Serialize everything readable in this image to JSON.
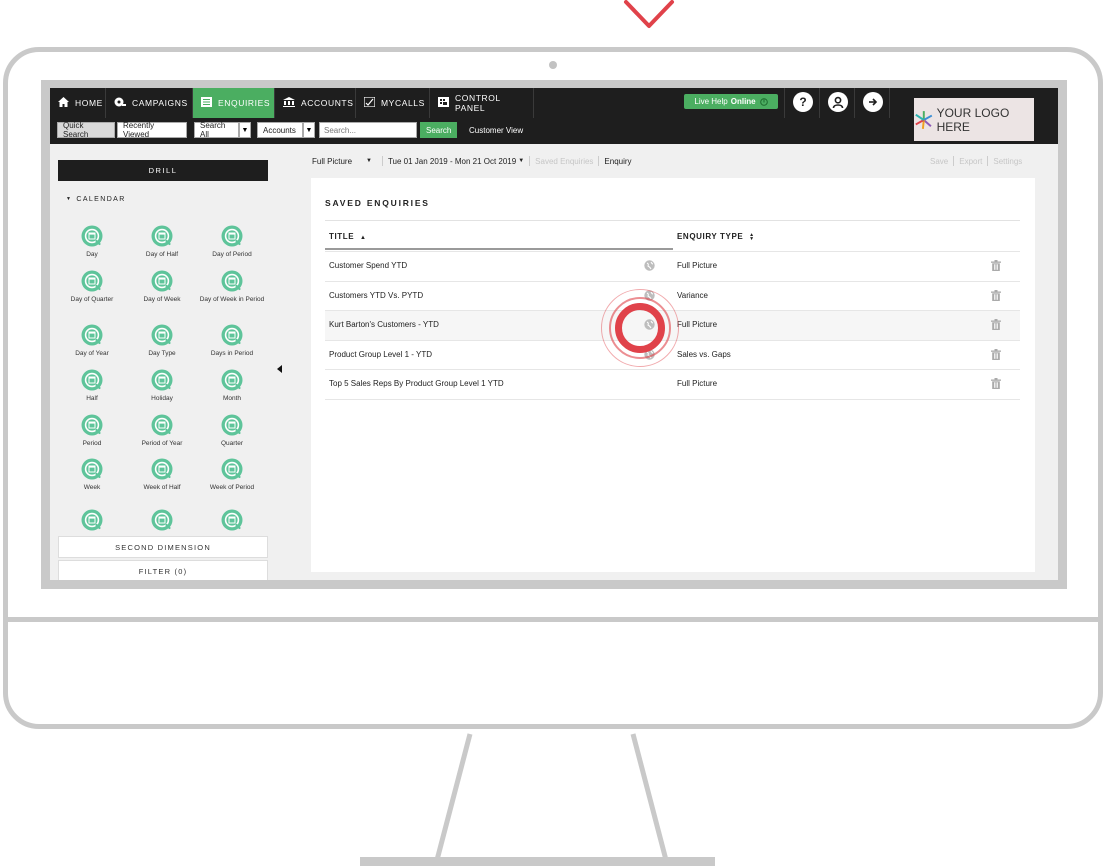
{
  "nav": {
    "items": [
      {
        "label": "HOME",
        "icon": "home-icon"
      },
      {
        "label": "CAMPAIGNS",
        "icon": "campaigns-icon"
      },
      {
        "label": "ENQUIRIES",
        "icon": "enquiries-icon",
        "active": true
      },
      {
        "label": "ACCOUNTS",
        "icon": "bank-icon"
      },
      {
        "label": "MYCALLS",
        "icon": "calls-icon"
      },
      {
        "label": "CONTROL PANEL",
        "icon": "grid-icon"
      }
    ],
    "live_help_prefix": "Live Help",
    "live_help_status": "Online",
    "help_glyph": "?",
    "logo_text": "YOUR LOGO HERE"
  },
  "search_bar": {
    "quick_search": "Quick Search",
    "recently_viewed": "Recently Viewed",
    "search_all": "Search All",
    "accounts": "Accounts",
    "search_placeholder": "Search...",
    "search_button": "Search",
    "customer_view": "Customer View"
  },
  "left_panel": {
    "drill_label": "DRILL",
    "calendar_label": "CALENDAR",
    "items": [
      "Day",
      "Day of Half",
      "Day of Period",
      "Day of Quarter",
      "Day of Week",
      "Day of Week in Period",
      "Day of Year",
      "Day Type",
      "Days in Period",
      "Half",
      "Holiday",
      "Month",
      "Period",
      "Period of Year",
      "Quarter",
      "Week",
      "Week of Half",
      "Week of Period"
    ],
    "second_dimension": "SECOND DIMENSION",
    "filter": "FILTER (0)"
  },
  "toolbar": {
    "view": "Full Picture",
    "date_range": "Tue 01 Jan 2019 - Mon 21 Oct 2019",
    "saved_enquiries": "Saved Enquiries",
    "enquiry": "Enquiry",
    "save": "Save",
    "export": "Export",
    "settings": "Settings"
  },
  "saved_enquiries": {
    "title": "SAVED ENQUIRIES",
    "col_title": "TITLE",
    "col_type": "ENQUIRY TYPE",
    "rows": [
      {
        "title": "Customer Spend YTD",
        "type": "Full Picture"
      },
      {
        "title": "Customers YTD Vs. PYTD",
        "type": "Variance"
      },
      {
        "title": "Kurt Barton's Customers - YTD",
        "type": "Full Picture"
      },
      {
        "title": "Product Group Level 1 - YTD",
        "type": "Sales vs. Gaps"
      },
      {
        "title": "Top 5 Sales Reps By Product Group Level 1 YTD",
        "type": "Full Picture"
      }
    ]
  },
  "colors": {
    "accent_green": "#4bae61",
    "nav_dark": "#1e1e1e",
    "ripple_red": "#e0424a",
    "monitor_gray": "#c9c9c9"
  }
}
